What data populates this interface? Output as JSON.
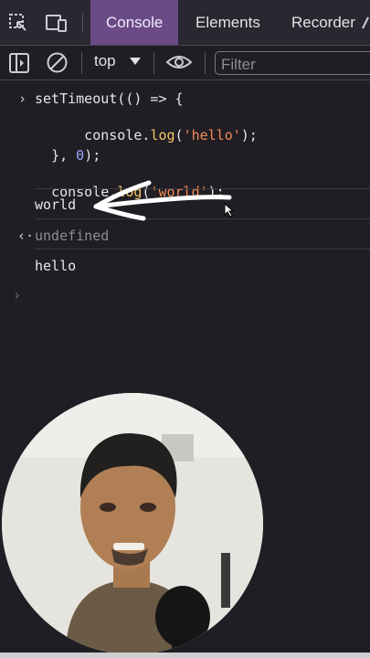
{
  "tabs": {
    "console": "Console",
    "elements": "Elements",
    "recorder": "Recorder"
  },
  "toolbar": {
    "context": "top",
    "filter_placeholder": "Filter"
  },
  "console": {
    "input_block": [
      "setTimeout(() => {",
      "    console.log('hello');",
      "}, 0);"
    ],
    "input_2": "console.log('world');",
    "output_world": "world",
    "return_value": "undefined",
    "output_hello": "hello"
  },
  "colors": {
    "active_tab": "#6a4b86",
    "string": "#f28b54",
    "function": "#f3c467",
    "number": "#9aa9ff"
  }
}
